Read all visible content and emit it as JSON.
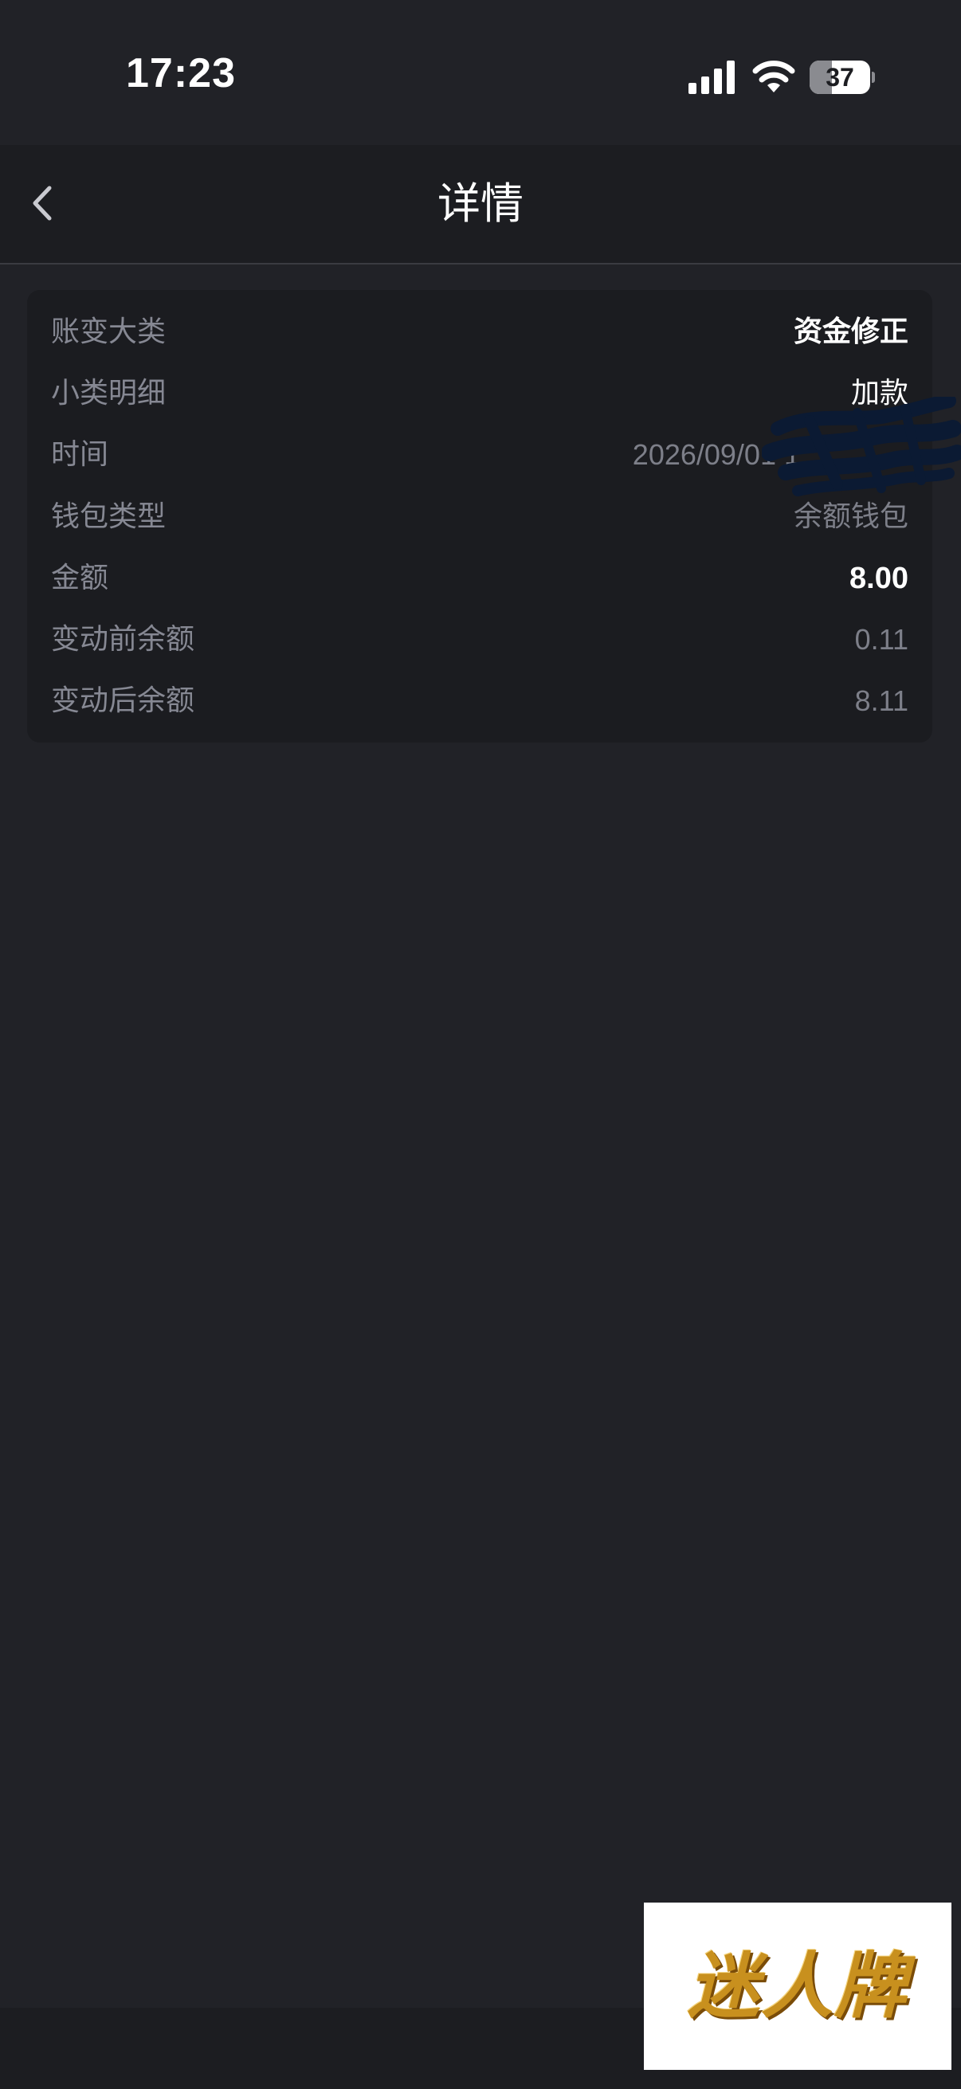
{
  "status_bar": {
    "time": "17:23",
    "battery_level": "37",
    "battery_fraction": 0.37,
    "icons": [
      "signal-icon",
      "wifi-icon",
      "battery-icon"
    ]
  },
  "nav": {
    "title": "详情",
    "back_icon": "chevron-left-icon"
  },
  "details": {
    "rows": [
      {
        "label": "账变大类",
        "value": "资金修正"
      },
      {
        "label": "小类明细",
        "value": "加款"
      },
      {
        "label": "时间",
        "value": "2026/09/01 1"
      },
      {
        "label": "钱包类型",
        "value": "余额钱包"
      },
      {
        "label": "金额",
        "value": "8.00"
      },
      {
        "label": "变动前余额",
        "value": "0.11"
      },
      {
        "label": "变动后余额",
        "value": "8.11"
      }
    ]
  },
  "watermark": {
    "text": "迷人牌"
  },
  "colors": {
    "background": "#212227",
    "nav_background": "#1c1d21",
    "card_background": "#1b1c20",
    "label_gray": "#868893",
    "value_gray": "#7d7f89",
    "redaction_ink": "#0b1a33",
    "battery_fill": "#8a8b90"
  }
}
